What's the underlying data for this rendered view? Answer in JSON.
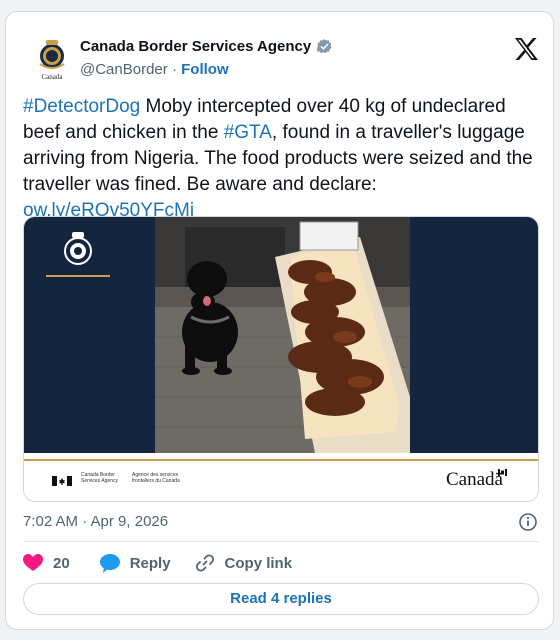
{
  "author": {
    "display_name": "Canada Border Services Agency",
    "handle": "@CanBorder",
    "separator": "·",
    "follow_label": "Follow",
    "avatar_wordmark": "Canada",
    "verified_icon": "verified-badge-icon"
  },
  "tweet": {
    "hashtag_1": "#DetectorDog",
    "text_1": " Moby intercepted over 40 kg of undeclared beef and chicken in the ",
    "hashtag_2": "#GTA",
    "text_2": ", found in a traveller's luggage arriving from Nigeria. The food products were seized and the traveller was fined. Be aware and declare: ",
    "link": "ow.ly/eROv50YFcMj"
  },
  "media": {
    "agency_en": "Canada Border\nServices Agency",
    "agency_fr": "Agence des services\nfrontaliers du Canada",
    "canada_wordmark": "Canadä",
    "colors": {
      "navy": "#14263f",
      "gold": "#c9a04a"
    }
  },
  "meta": {
    "timestamp": "7:02 AM · Apr 9, 2026"
  },
  "actions": {
    "like_count": "20",
    "reply_label": "Reply",
    "copy_link_label": "Copy link",
    "read_replies_label": "Read 4 replies"
  },
  "colors": {
    "link": "#1d73b8",
    "like": "#f91880",
    "reply_bubble": "#1d9bf0",
    "muted": "#536471"
  }
}
